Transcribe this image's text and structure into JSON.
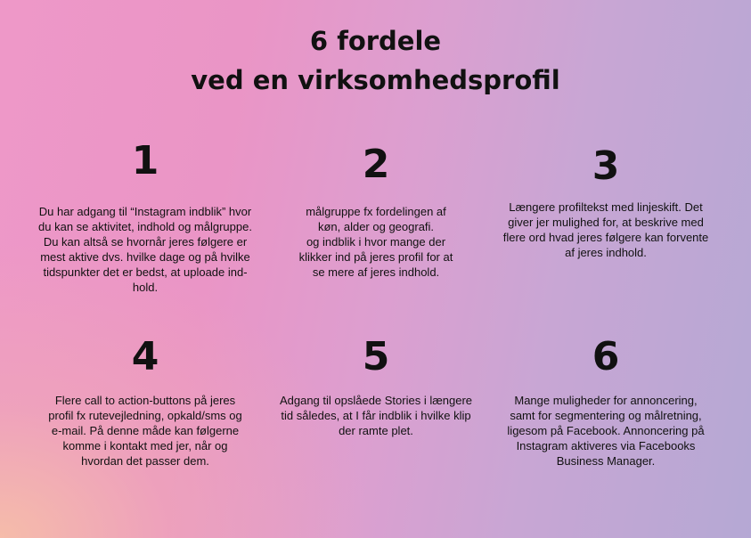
{
  "title": {
    "line1": "6 fordele",
    "line2": "ved en virksomhedsprofil"
  },
  "benefits": [
    {
      "number": "1",
      "lines": [
        "Du har adgang til “Instagram indblik” hvor",
        "du kan se aktivitet, indhold og målgruppe.",
        "Du kan altså se hvornår jeres følgere er",
        "mest aktive dvs. hvilke dage og på hvilke",
        "tidspunkter det er bedst, at uploade ind-",
        "hold."
      ]
    },
    {
      "number": "2",
      "lines": [
        "målgruppe fx fordelingen af",
        "køn, alder og geografi.",
        "og indblik i hvor mange der",
        "klikker ind på jeres profil for at",
        "se mere af jeres indhold."
      ]
    },
    {
      "number": "3",
      "lines": [
        "Længere profiltekst med linjeskift. Det",
        "giver jer mulighed for, at beskrive med",
        "flere ord hvad jeres følgere kan forvente",
        "af jeres indhold."
      ]
    },
    {
      "number": "4",
      "lines": [
        "Flere call to action-buttons på jeres",
        "profil fx rutevejledning, opkald/sms og",
        "e-mail. På denne måde kan følgerne",
        "komme i kontakt med jer, når og",
        "hvordan det passer dem."
      ]
    },
    {
      "number": "5",
      "lines": [
        "Adgang til opslåede Stories i længere",
        "tid således, at I får indblik i hvilke klip",
        "der ramte plet."
      ]
    },
    {
      "number": "6",
      "lines": [
        "Mange muligheder for annoncering,",
        "samt for segmentering og målretning,",
        "ligesom på Facebook. Annoncering på",
        "Instagram aktiveres via Facebooks",
        "Business Manager."
      ]
    }
  ]
}
